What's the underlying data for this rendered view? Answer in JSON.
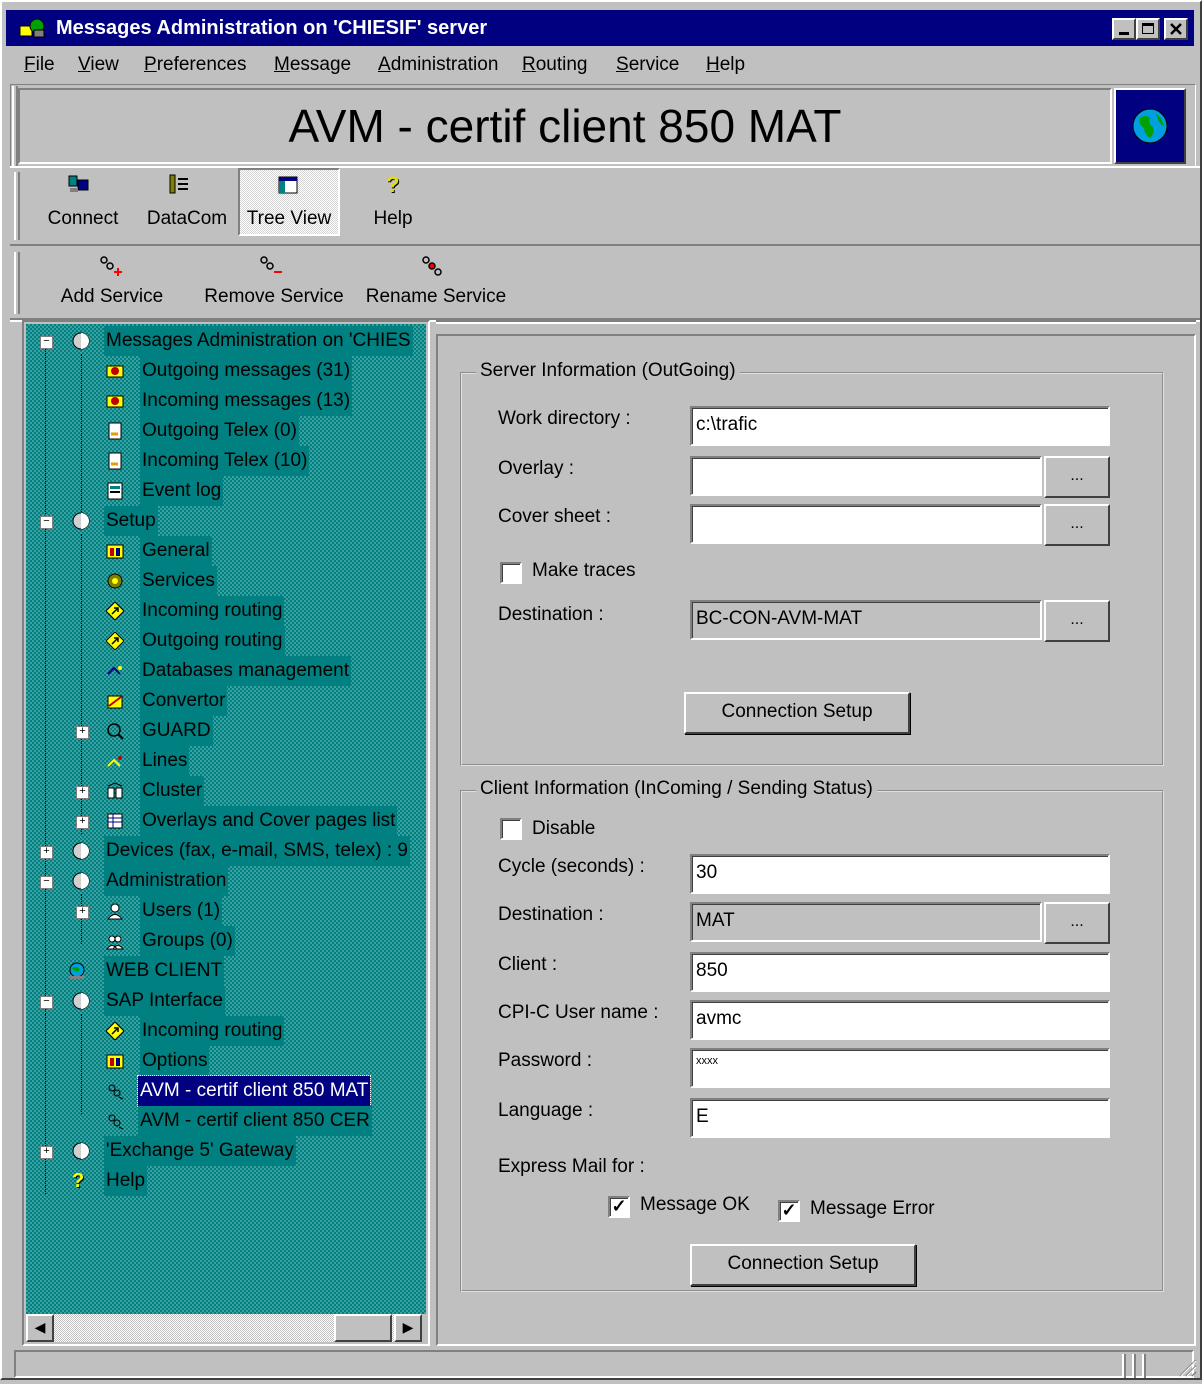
{
  "window": {
    "title": "Messages Administration on 'CHIESIF' server"
  },
  "menu": [
    {
      "label": "File",
      "key": "F"
    },
    {
      "label": "View",
      "key": "V"
    },
    {
      "label": "Preferences",
      "key": "P"
    },
    {
      "label": "Message",
      "key": "M"
    },
    {
      "label": "Administration",
      "key": "A"
    },
    {
      "label": "Routing",
      "key": "R"
    },
    {
      "label": "Service",
      "key": "S"
    },
    {
      "label": "Help",
      "key": "H"
    }
  ],
  "banner": {
    "title": "AVM - certif client 850 MAT"
  },
  "toolbar": {
    "connect": "Connect",
    "datacom": "DataCom",
    "treeview": "Tree View",
    "help": "Help"
  },
  "service_toolbar": {
    "add": "Add Service",
    "remove": "Remove Service",
    "rename": "Rename Service"
  },
  "tree": {
    "root": "Messages Administration on 'CHIES",
    "outgoing_messages": "Outgoing messages (31)",
    "incoming_messages": "Incoming messages (13)",
    "outgoing_telex": "Outgoing Telex (0)",
    "incoming_telex": "Incoming Telex (10)",
    "event_log": "Event log",
    "setup": "Setup",
    "general": "General",
    "services": "Services",
    "incoming_routing": "Incoming routing",
    "outgoing_routing": "Outgoing routing",
    "databases": "Databases management",
    "convertor": "Convertor",
    "guard": "GUARD",
    "lines": "Lines",
    "cluster": "Cluster",
    "overlays": "Overlays and Cover pages list",
    "devices": "Devices (fax, e-mail, SMS, telex) : 9",
    "administration": "Administration",
    "users": "Users (1)",
    "groups": "Groups (0)",
    "web_client": "WEB CLIENT",
    "sap_interface": "SAP Interface",
    "sap_incoming_routing": "Incoming routing",
    "sap_options": "Options",
    "sap_mat": "AVM - certif client 850 MAT",
    "sap_cer": "AVM - certif client 850 CER",
    "exchange": "'Exchange 5' Gateway",
    "help": "Help"
  },
  "server": {
    "group_title": "Server Information (OutGoing)",
    "work_dir_label": "Work directory :",
    "work_dir_value": "c:\\trafic",
    "overlay_label": "Overlay :",
    "overlay_value": "",
    "cover_label": "Cover sheet :",
    "cover_value": "",
    "traces_label": "Make traces",
    "traces_checked": false,
    "dest_label": "Destination :",
    "dest_value": "BC-CON-AVM-MAT",
    "connection_button": "Connection Setup",
    "browse": "..."
  },
  "client": {
    "group_title": "Client Information (InComing / Sending Status)",
    "disable_label": "Disable",
    "disable_checked": false,
    "cycle_label": "Cycle (seconds) :",
    "cycle_value": "30",
    "dest_label": "Destination :",
    "dest_value": "MAT",
    "client_label": "Client :",
    "client_value": "850",
    "user_label": "CPI-C User name :",
    "user_value": "avmc",
    "password_label": "Password :",
    "password_value": "xxxx",
    "language_label": "Language :",
    "language_value": "E",
    "express_label": "Express Mail for :",
    "msg_ok_label": "Message OK",
    "msg_ok_checked": true,
    "msg_err_label": "Message Error",
    "msg_err_checked": true,
    "connection_button": "Connection Setup",
    "browse": "..."
  },
  "colors": {
    "title_bg": "#000080",
    "tree_bg": "#008080",
    "face": "#c0c0c0"
  }
}
